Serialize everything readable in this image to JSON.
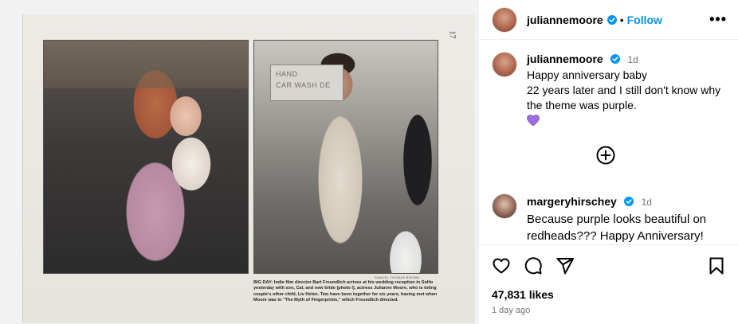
{
  "post": {
    "username": "juliannemoore",
    "follow_label": "Follow",
    "more_label": "•••",
    "dot": "•"
  },
  "image": {
    "page_number": "17",
    "store_sign_line1": "HAND",
    "store_sign_line2": "CAR WASH DE",
    "photo_credit": "SAMUEL THOMAS BROWN",
    "caption": "BIG DAY: Indie film director Bart Freundlich arrives at his wedding reception in SoHo yesterday with son, Cal, and new bride (photo l), actress Julianne Moore, who is toting couple's other child, Liv Helen. Two have been together for six years, having met when Moore was in \"The Myth of Fingerprints,\" which Freundlich directed."
  },
  "comments": [
    {
      "username": "juliannemoore",
      "time": "1d",
      "lines": [
        "Happy anniversary baby",
        "22 years later and I still don't know why",
        "the theme was purple."
      ],
      "emoji": "💜"
    },
    {
      "username": "margeryhirschey",
      "time": "1d",
      "lines": [
        "Because purple looks beautiful on",
        "redheads??? Happy Anniversary!"
      ]
    }
  ],
  "actions": {
    "likes": "47,831 likes",
    "date": "1 day ago"
  },
  "colors": {
    "accent": "#0095f6",
    "verified": "#0095f6",
    "muted": "#737373"
  },
  "icons": [
    "verified-badge-icon",
    "heart-icon",
    "comment-icon",
    "share-icon",
    "bookmark-icon",
    "add-circle-icon",
    "more-options-icon"
  ]
}
